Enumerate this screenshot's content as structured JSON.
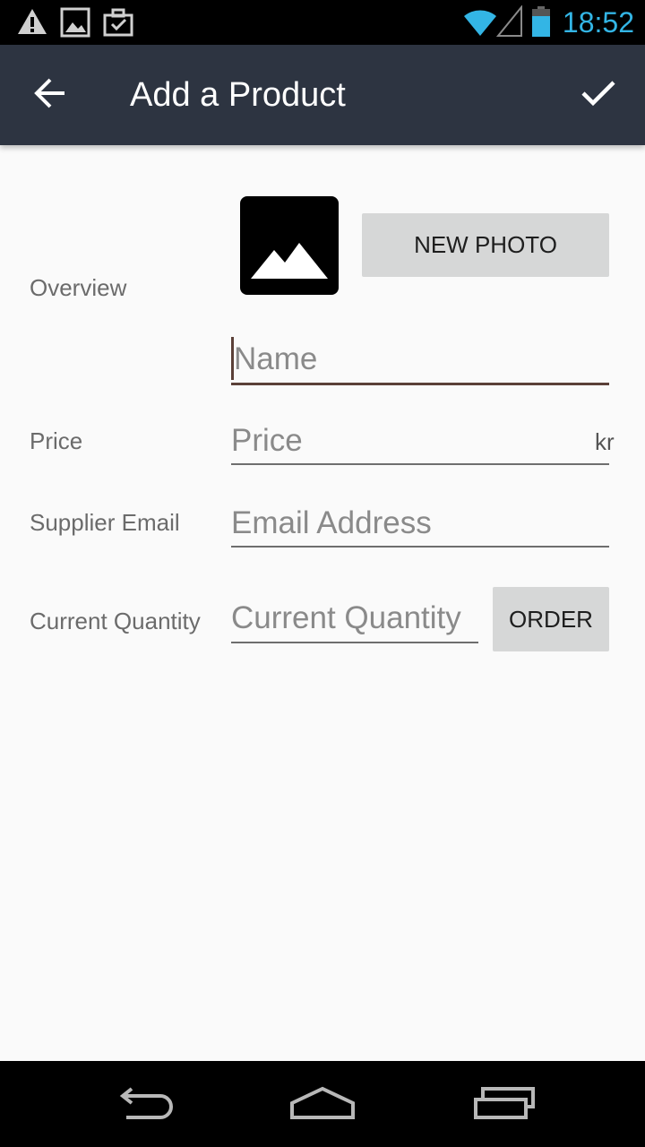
{
  "status_bar": {
    "time": "18:52",
    "icons": [
      "warning-icon",
      "image-icon",
      "briefcase-icon",
      "wifi-icon",
      "signal-icon",
      "battery-icon"
    ]
  },
  "app_bar": {
    "title": "Add a Product",
    "back_icon": "arrow-left-icon",
    "save_icon": "check-icon"
  },
  "form": {
    "overview_label": "Overview",
    "new_photo_label": "NEW PHOTO",
    "name_placeholder": "Name",
    "name_value": "",
    "price_label": "Price",
    "price_placeholder": "Price",
    "price_value": "",
    "currency": "kr",
    "email_label": "Supplier Email",
    "email_placeholder": "Email Address",
    "email_value": "",
    "quantity_label": "Current Quantity",
    "quantity_placeholder": "Current Quantity",
    "quantity_value": "",
    "order_label": "ORDER"
  },
  "nav_bar": {
    "icons": [
      "back-nav-icon",
      "home-nav-icon",
      "recents-nav-icon"
    ]
  },
  "colors": {
    "app_bar": "#2d3441",
    "status_accent": "#33b5e5",
    "field_focus": "#5b4038",
    "button_bg": "#d6d7d7"
  }
}
